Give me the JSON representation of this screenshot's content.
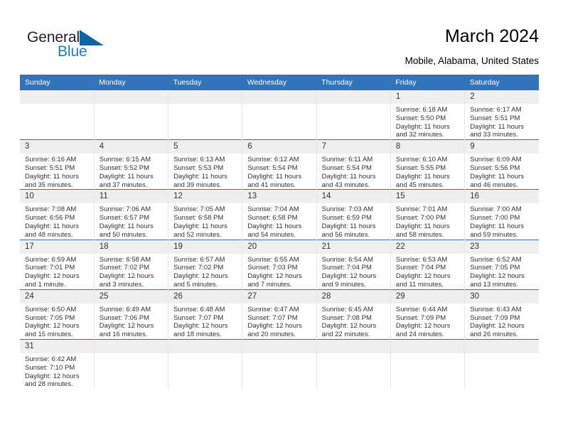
{
  "brand": {
    "name_dark": "General",
    "name_blue": "Blue",
    "logo_color": "#2279c4",
    "icon": "flag-triangle-icon"
  },
  "header": {
    "title": "March 2024",
    "subtitle": "Mobile, Alabama, United States",
    "accent_color": "#3373b8",
    "daynum_bg": "#efefef"
  },
  "calendar": {
    "weekday_headers": [
      "Sunday",
      "Monday",
      "Tuesday",
      "Wednesday",
      "Thursday",
      "Friday",
      "Saturday"
    ],
    "weeks": [
      [
        {
          "day": "",
          "sunrise": "",
          "sunset": "",
          "daylight": "",
          "empty": true
        },
        {
          "day": "",
          "sunrise": "",
          "sunset": "",
          "daylight": "",
          "empty": true
        },
        {
          "day": "",
          "sunrise": "",
          "sunset": "",
          "daylight": "",
          "empty": true
        },
        {
          "day": "",
          "sunrise": "",
          "sunset": "",
          "daylight": "",
          "empty": true
        },
        {
          "day": "",
          "sunrise": "",
          "sunset": "",
          "daylight": "",
          "empty": true
        },
        {
          "day": "1",
          "sunrise": "Sunrise: 6:18 AM",
          "sunset": "Sunset: 5:50 PM",
          "daylight": "Daylight: 11 hours and 32 minutes.",
          "empty": false
        },
        {
          "day": "2",
          "sunrise": "Sunrise: 6:17 AM",
          "sunset": "Sunset: 5:51 PM",
          "daylight": "Daylight: 11 hours and 33 minutes.",
          "empty": false
        }
      ],
      [
        {
          "day": "3",
          "sunrise": "Sunrise: 6:16 AM",
          "sunset": "Sunset: 5:51 PM",
          "daylight": "Daylight: 11 hours and 35 minutes.",
          "empty": false
        },
        {
          "day": "4",
          "sunrise": "Sunrise: 6:15 AM",
          "sunset": "Sunset: 5:52 PM",
          "daylight": "Daylight: 11 hours and 37 minutes.",
          "empty": false
        },
        {
          "day": "5",
          "sunrise": "Sunrise: 6:13 AM",
          "sunset": "Sunset: 5:53 PM",
          "daylight": "Daylight: 11 hours and 39 minutes.",
          "empty": false
        },
        {
          "day": "6",
          "sunrise": "Sunrise: 6:12 AM",
          "sunset": "Sunset: 5:54 PM",
          "daylight": "Daylight: 11 hours and 41 minutes.",
          "empty": false
        },
        {
          "day": "7",
          "sunrise": "Sunrise: 6:11 AM",
          "sunset": "Sunset: 5:54 PM",
          "daylight": "Daylight: 11 hours and 43 minutes.",
          "empty": false
        },
        {
          "day": "8",
          "sunrise": "Sunrise: 6:10 AM",
          "sunset": "Sunset: 5:55 PM",
          "daylight": "Daylight: 11 hours and 45 minutes.",
          "empty": false
        },
        {
          "day": "9",
          "sunrise": "Sunrise: 6:09 AM",
          "sunset": "Sunset: 5:56 PM",
          "daylight": "Daylight: 11 hours and 46 minutes.",
          "empty": false
        }
      ],
      [
        {
          "day": "10",
          "sunrise": "Sunrise: 7:08 AM",
          "sunset": "Sunset: 6:56 PM",
          "daylight": "Daylight: 11 hours and 48 minutes.",
          "empty": false
        },
        {
          "day": "11",
          "sunrise": "Sunrise: 7:06 AM",
          "sunset": "Sunset: 6:57 PM",
          "daylight": "Daylight: 11 hours and 50 minutes.",
          "empty": false
        },
        {
          "day": "12",
          "sunrise": "Sunrise: 7:05 AM",
          "sunset": "Sunset: 6:58 PM",
          "daylight": "Daylight: 11 hours and 52 minutes.",
          "empty": false
        },
        {
          "day": "13",
          "sunrise": "Sunrise: 7:04 AM",
          "sunset": "Sunset: 6:58 PM",
          "daylight": "Daylight: 11 hours and 54 minutes.",
          "empty": false
        },
        {
          "day": "14",
          "sunrise": "Sunrise: 7:03 AM",
          "sunset": "Sunset: 6:59 PM",
          "daylight": "Daylight: 11 hours and 56 minutes.",
          "empty": false
        },
        {
          "day": "15",
          "sunrise": "Sunrise: 7:01 AM",
          "sunset": "Sunset: 7:00 PM",
          "daylight": "Daylight: 11 hours and 58 minutes.",
          "empty": false
        },
        {
          "day": "16",
          "sunrise": "Sunrise: 7:00 AM",
          "sunset": "Sunset: 7:00 PM",
          "daylight": "Daylight: 11 hours and 59 minutes.",
          "empty": false
        }
      ],
      [
        {
          "day": "17",
          "sunrise": "Sunrise: 6:59 AM",
          "sunset": "Sunset: 7:01 PM",
          "daylight": "Daylight: 12 hours and 1 minute.",
          "empty": false
        },
        {
          "day": "18",
          "sunrise": "Sunrise: 6:58 AM",
          "sunset": "Sunset: 7:02 PM",
          "daylight": "Daylight: 12 hours and 3 minutes.",
          "empty": false
        },
        {
          "day": "19",
          "sunrise": "Sunrise: 6:57 AM",
          "sunset": "Sunset: 7:02 PM",
          "daylight": "Daylight: 12 hours and 5 minutes.",
          "empty": false
        },
        {
          "day": "20",
          "sunrise": "Sunrise: 6:55 AM",
          "sunset": "Sunset: 7:03 PM",
          "daylight": "Daylight: 12 hours and 7 minutes.",
          "empty": false
        },
        {
          "day": "21",
          "sunrise": "Sunrise: 6:54 AM",
          "sunset": "Sunset: 7:04 PM",
          "daylight": "Daylight: 12 hours and 9 minutes.",
          "empty": false
        },
        {
          "day": "22",
          "sunrise": "Sunrise: 6:53 AM",
          "sunset": "Sunset: 7:04 PM",
          "daylight": "Daylight: 12 hours and 11 minutes.",
          "empty": false
        },
        {
          "day": "23",
          "sunrise": "Sunrise: 6:52 AM",
          "sunset": "Sunset: 7:05 PM",
          "daylight": "Daylight: 12 hours and 13 minutes.",
          "empty": false
        }
      ],
      [
        {
          "day": "24",
          "sunrise": "Sunrise: 6:50 AM",
          "sunset": "Sunset: 7:05 PM",
          "daylight": "Daylight: 12 hours and 15 minutes.",
          "empty": false
        },
        {
          "day": "25",
          "sunrise": "Sunrise: 6:49 AM",
          "sunset": "Sunset: 7:06 PM",
          "daylight": "Daylight: 12 hours and 16 minutes.",
          "empty": false
        },
        {
          "day": "26",
          "sunrise": "Sunrise: 6:48 AM",
          "sunset": "Sunset: 7:07 PM",
          "daylight": "Daylight: 12 hours and 18 minutes.",
          "empty": false
        },
        {
          "day": "27",
          "sunrise": "Sunrise: 6:47 AM",
          "sunset": "Sunset: 7:07 PM",
          "daylight": "Daylight: 12 hours and 20 minutes.",
          "empty": false
        },
        {
          "day": "28",
          "sunrise": "Sunrise: 6:45 AM",
          "sunset": "Sunset: 7:08 PM",
          "daylight": "Daylight: 12 hours and 22 minutes.",
          "empty": false
        },
        {
          "day": "29",
          "sunrise": "Sunrise: 6:44 AM",
          "sunset": "Sunset: 7:09 PM",
          "daylight": "Daylight: 12 hours and 24 minutes.",
          "empty": false
        },
        {
          "day": "30",
          "sunrise": "Sunrise: 6:43 AM",
          "sunset": "Sunset: 7:09 PM",
          "daylight": "Daylight: 12 hours and 26 minutes.",
          "empty": false
        }
      ],
      [
        {
          "day": "31",
          "sunrise": "Sunrise: 6:42 AM",
          "sunset": "Sunset: 7:10 PM",
          "daylight": "Daylight: 12 hours and 28 minutes.",
          "empty": false
        },
        {
          "day": "",
          "sunrise": "",
          "sunset": "",
          "daylight": "",
          "empty": true
        },
        {
          "day": "",
          "sunrise": "",
          "sunset": "",
          "daylight": "",
          "empty": true
        },
        {
          "day": "",
          "sunrise": "",
          "sunset": "",
          "daylight": "",
          "empty": true
        },
        {
          "day": "",
          "sunrise": "",
          "sunset": "",
          "daylight": "",
          "empty": true
        },
        {
          "day": "",
          "sunrise": "",
          "sunset": "",
          "daylight": "",
          "empty": true
        },
        {
          "day": "",
          "sunrise": "",
          "sunset": "",
          "daylight": "",
          "empty": true
        }
      ]
    ]
  }
}
